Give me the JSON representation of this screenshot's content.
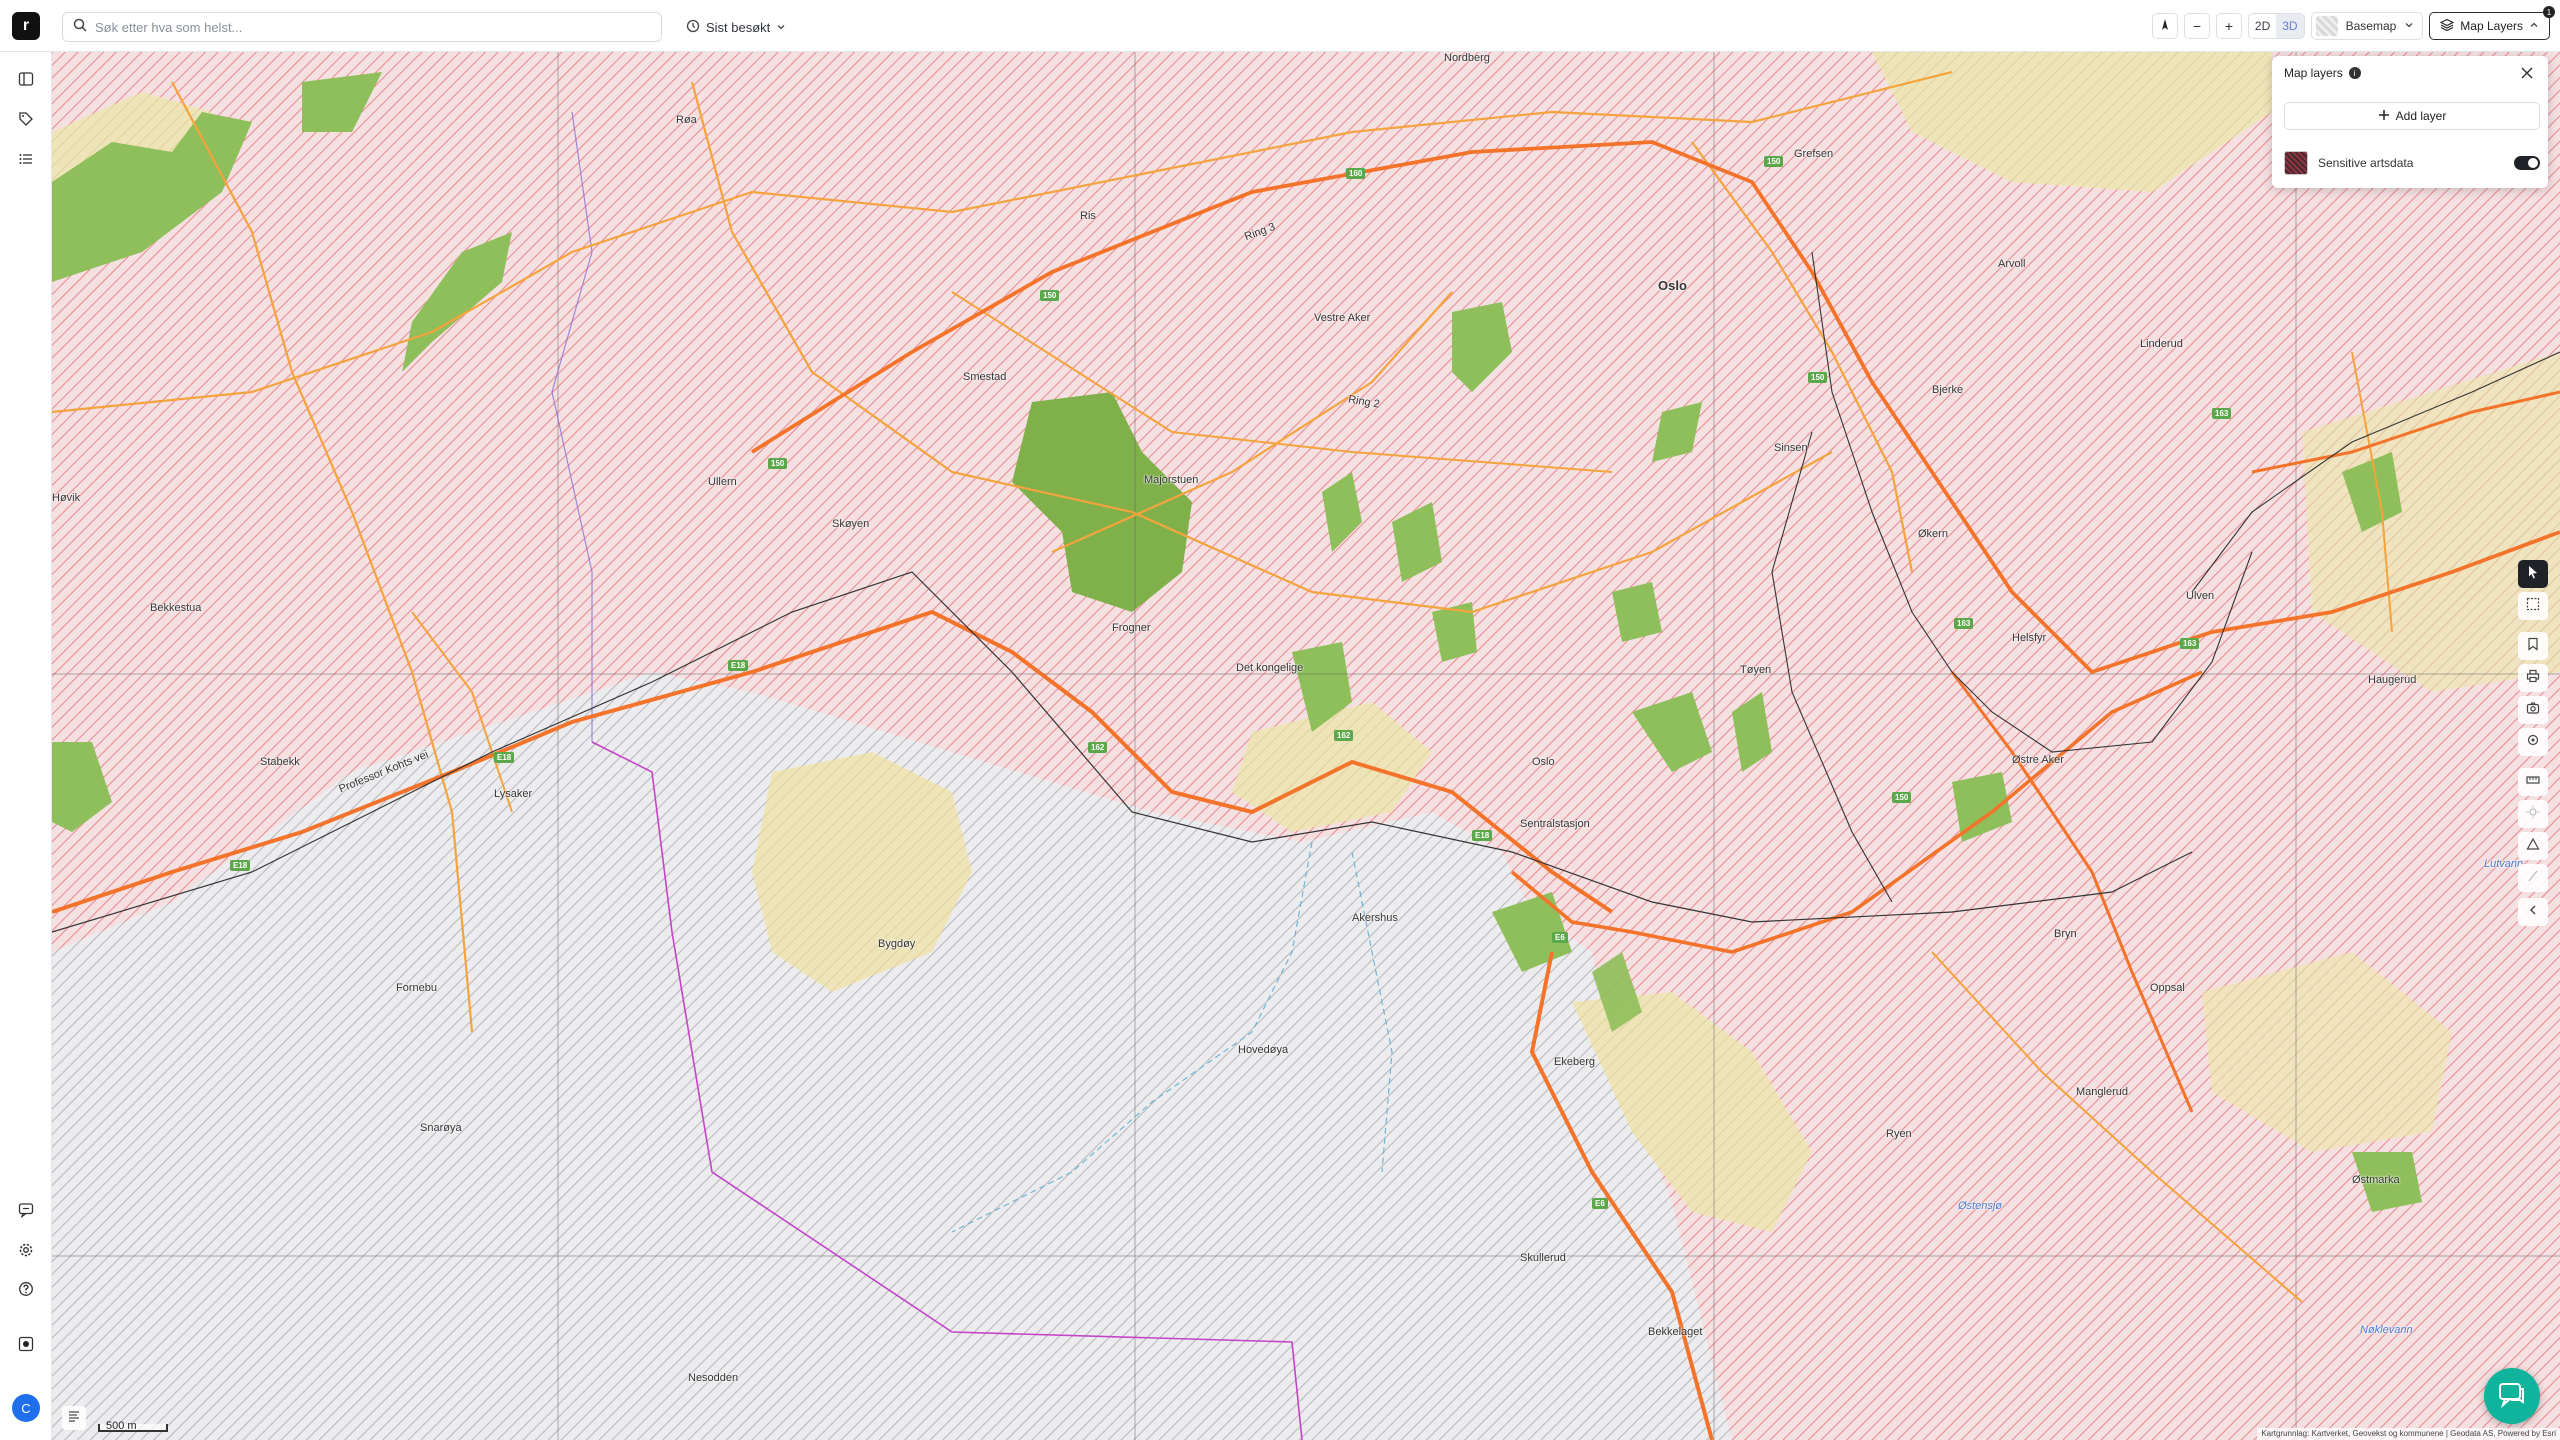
{
  "app": {
    "logo_letter": "r"
  },
  "search": {
    "placeholder": "Søk etter hva som helst..."
  },
  "recent": {
    "label": "Sist besøkt"
  },
  "view_toggle": {
    "two_d": "2D",
    "three_d": "3D"
  },
  "basemap": {
    "label": "Basemap"
  },
  "map_layers_button": {
    "label": "Map Layers",
    "badge": "1"
  },
  "layers_panel": {
    "title": "Map layers",
    "info": "i",
    "add_layer_label": "Add layer",
    "layers": [
      {
        "name": "Sensitive artsdata",
        "enabled": true
      }
    ]
  },
  "user": {
    "initial": "C"
  },
  "scale": {
    "label": "500 m"
  },
  "attribution": "Kartgrunnlag: Kartverket, Geovekst og kommunene | Geodata AS, Powered by Esri",
  "map_labels": [
    {
      "text": "Nordberg"
    },
    {
      "text": "Røa"
    },
    {
      "text": "Ris"
    },
    {
      "text": "Grefsen"
    },
    {
      "text": "Oslo"
    },
    {
      "text": "Vestre Aker"
    },
    {
      "text": "Smestad"
    },
    {
      "text": "Arvoll"
    },
    {
      "text": "Linderud"
    },
    {
      "text": "Bjerke"
    },
    {
      "text": "Sinsen"
    },
    {
      "text": "Ullern"
    },
    {
      "text": "Skøyen"
    },
    {
      "text": "Majorstuen"
    },
    {
      "text": "Frogner"
    },
    {
      "text": "Det kongelige"
    },
    {
      "text": "Økern"
    },
    {
      "text": "Tøyen"
    },
    {
      "text": "Helsfyr"
    },
    {
      "text": "Haugerud"
    },
    {
      "text": "Bekkestua"
    },
    {
      "text": "Stabekk"
    },
    {
      "text": "Lysaker"
    },
    {
      "text": "Oslo"
    },
    {
      "text": "Sentralstasjon"
    },
    {
      "text": "Østre Aker"
    },
    {
      "text": "Akershus"
    },
    {
      "text": "Bygdøy"
    },
    {
      "text": "Fornebu"
    },
    {
      "text": "Bryn"
    },
    {
      "text": "Oppsal"
    },
    {
      "text": "Hovedøya"
    },
    {
      "text": "Ekeberg"
    },
    {
      "text": "Manglerud"
    },
    {
      "text": "Snarøya"
    },
    {
      "text": "Ryen"
    },
    {
      "text": "Østmarka"
    },
    {
      "text": "Østensjø"
    },
    {
      "text": "Nesodden"
    },
    {
      "text": "Bekkelaget"
    },
    {
      "text": "Skullerud"
    },
    {
      "text": "Ring 3"
    },
    {
      "text": "Ring 2"
    },
    {
      "text": "Professor Kohts vei"
    },
    {
      "text": "Nøklevann"
    },
    {
      "text": "Lutvann"
    },
    {
      "text": "Høvik"
    },
    {
      "text": "Ulven"
    }
  ],
  "colors": {
    "urban_hatch": "#e8757a",
    "urban_fill": "#f3d9dc",
    "forest": "#8fbf5a",
    "road_major": "#f3732a",
    "road_minor": "#f5a33c",
    "water_hatch": "#9a9aa3",
    "boundary": "#c542c9",
    "accent": "#10b39b"
  }
}
